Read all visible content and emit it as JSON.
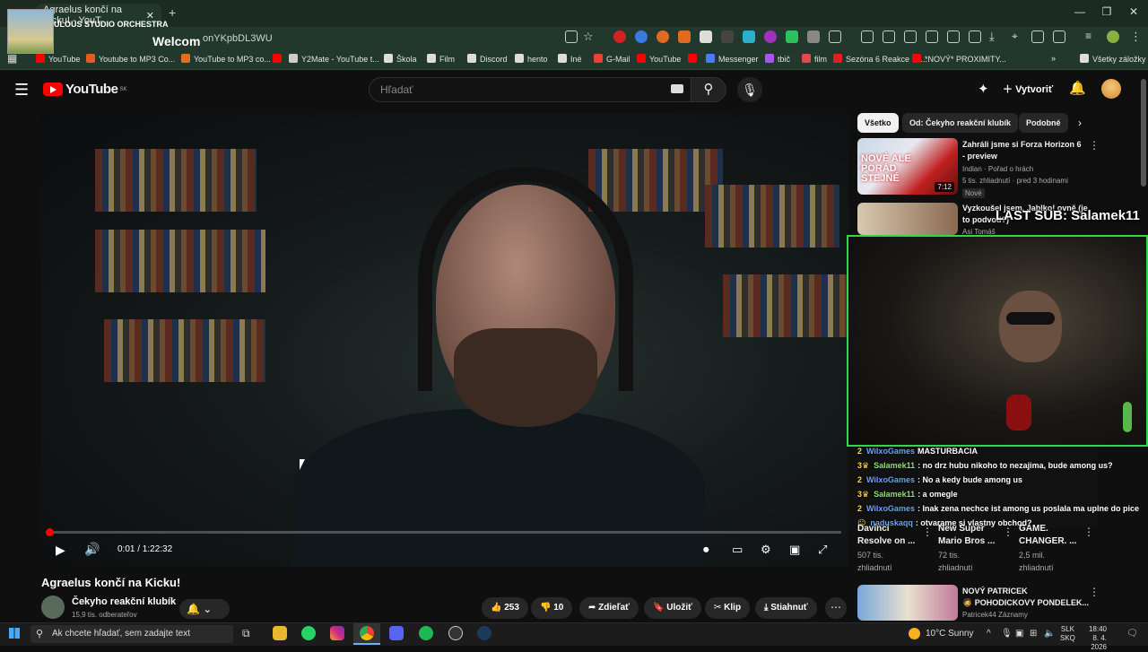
{
  "browser": {
    "tab_title": "Agraelus končí na Kicku! - YouT",
    "tab_close": "✕",
    "new_tab": "+",
    "url": "onYKpbDL3WU",
    "window_controls": [
      "—",
      "❐",
      "✕"
    ],
    "bookmarks": [
      {
        "label": "YouTube",
        "color": "#f00"
      },
      {
        "label": "Youtube to MP3 Co...",
        "color": "#e85a20"
      },
      {
        "label": "YouTube to MP3 co...",
        "color": "#e07020"
      },
      {
        "label": "",
        "color": "#f00"
      },
      {
        "label": "Y2Mate - YouTube t...",
        "color": "#ccc"
      },
      {
        "label": "Škola",
        "color": "#ddd"
      },
      {
        "label": "Film",
        "color": "#ddd"
      },
      {
        "label": "Discord",
        "color": "#ddd"
      },
      {
        "label": "hento",
        "color": "#ddd"
      },
      {
        "label": "Iné",
        "color": "#ddd"
      },
      {
        "label": "G-Mail",
        "color": "#ea4335"
      },
      {
        "label": "YouTube",
        "color": "#f00"
      },
      {
        "label": "",
        "color": "#f00"
      },
      {
        "label": "Messenger",
        "color": "#4a7aff"
      },
      {
        "label": "tbič",
        "color": "#a855f7"
      },
      {
        "label": "film",
        "color": "#e24a4a"
      },
      {
        "label": "Sezóna 6 Reakce na...",
        "color": "#e02020"
      },
      {
        "label": "*NOVÝ* PROXIMITY...",
        "color": "#f00"
      }
    ],
    "bookmarks_more": "»",
    "all_bookmarks": "Všetky záložky"
  },
  "overlay": {
    "title": "ULOUS STUDIO ORCHESTRA",
    "welcome": "Welcom",
    "last_sub": "LAST SUB: Salamek11"
  },
  "youtube": {
    "logo": "YouTube",
    "region": "SK",
    "search_placeholder": "Hľadať",
    "create_label": "Vytvoriť",
    "video": {
      "time": "0:01 / 1:22:32",
      "progress": 0.0002,
      "title": "Agraelus končí na Kicku!",
      "channel": "Čekyho reakční klubík",
      "subscribers": "15,9 tis. odberateľov",
      "likes": "253",
      "dislikes": "10",
      "share": "Zdieľať",
      "save": "Uložiť",
      "clip": "Klip",
      "download": "Stiahnuť"
    },
    "chips": [
      "Všetko",
      "Od: Čekyho reakční klubík",
      "Podobné"
    ],
    "recommended": [
      {
        "title_line1": "Zahráli jsme si Forza Horizon 6",
        "title_line2": "- preview",
        "channel": "Indian · Pořad o hrách",
        "views": "5 tis. zhliadnutí · pred 3 hodinami",
        "badge": "Nové",
        "duration": "7:12",
        "thumb_text": "NOVÉ ALE PORÁD STEJNÉ"
      },
      {
        "title_line1": "Vyzkoušel jsem, Jablko! ovně (je",
        "title_line2": "to podvod?)",
        "channel": "Asi Tomáš"
      }
    ],
    "shorts": [
      {
        "title_line1": "Davinci",
        "title_line2": "Resolve on ...",
        "views_line1": "507 tis.",
        "views_line2": "zhliadnutí"
      },
      {
        "title_line1": "New Super",
        "title_line2": "Mario Bros ...",
        "views_line1": "72 tis.",
        "views_line2": "zhliadnutí"
      },
      {
        "title_line1": "GAME.",
        "title_line2": "CHANGER. ...",
        "views_line1": "2,5 mil.",
        "views_line2": "zhliadnutí"
      }
    ],
    "bottom_rec": {
      "title_line1": "NOVÝ PATRICEK",
      "title_line2": "🧔 POHODICKOVY PONDELEK...",
      "channel": "Patricek44 Záznamy"
    }
  },
  "chat": [
    {
      "badge": "2",
      "user": "WilxoGames",
      "text": "MASTURBACIA"
    },
    {
      "badge": "3♛",
      "user": "Salamek11",
      "text": ": no drz hubu nikoho to nezajima, bude among us?"
    },
    {
      "badge": "2",
      "user": "WilxoGames",
      "text": ": No a kedy bude among us"
    },
    {
      "badge": "3♛",
      "user": "Salamek11",
      "text": ": a omegle"
    },
    {
      "badge": "2",
      "user": "WilxoGames",
      "text": ": Inak zena nechce ist among us poslala ma uplne do pice"
    },
    {
      "badge": "😐",
      "user": "naduskaqq",
      "text": ": otvarame si vlastny obchod?"
    }
  ],
  "taskbar": {
    "search_placeholder": "Ak chcete hľadať, sem zadajte text",
    "weather": "10°C  Sunny",
    "lang_line1": "SLK",
    "lang_line2": "SKQ",
    "time": "18:40",
    "date": "8. 4. 2026"
  },
  "colors": {
    "accent": "#ff0000",
    "cam_border": "#2fd84a",
    "chrome_bg": "#22382c"
  }
}
